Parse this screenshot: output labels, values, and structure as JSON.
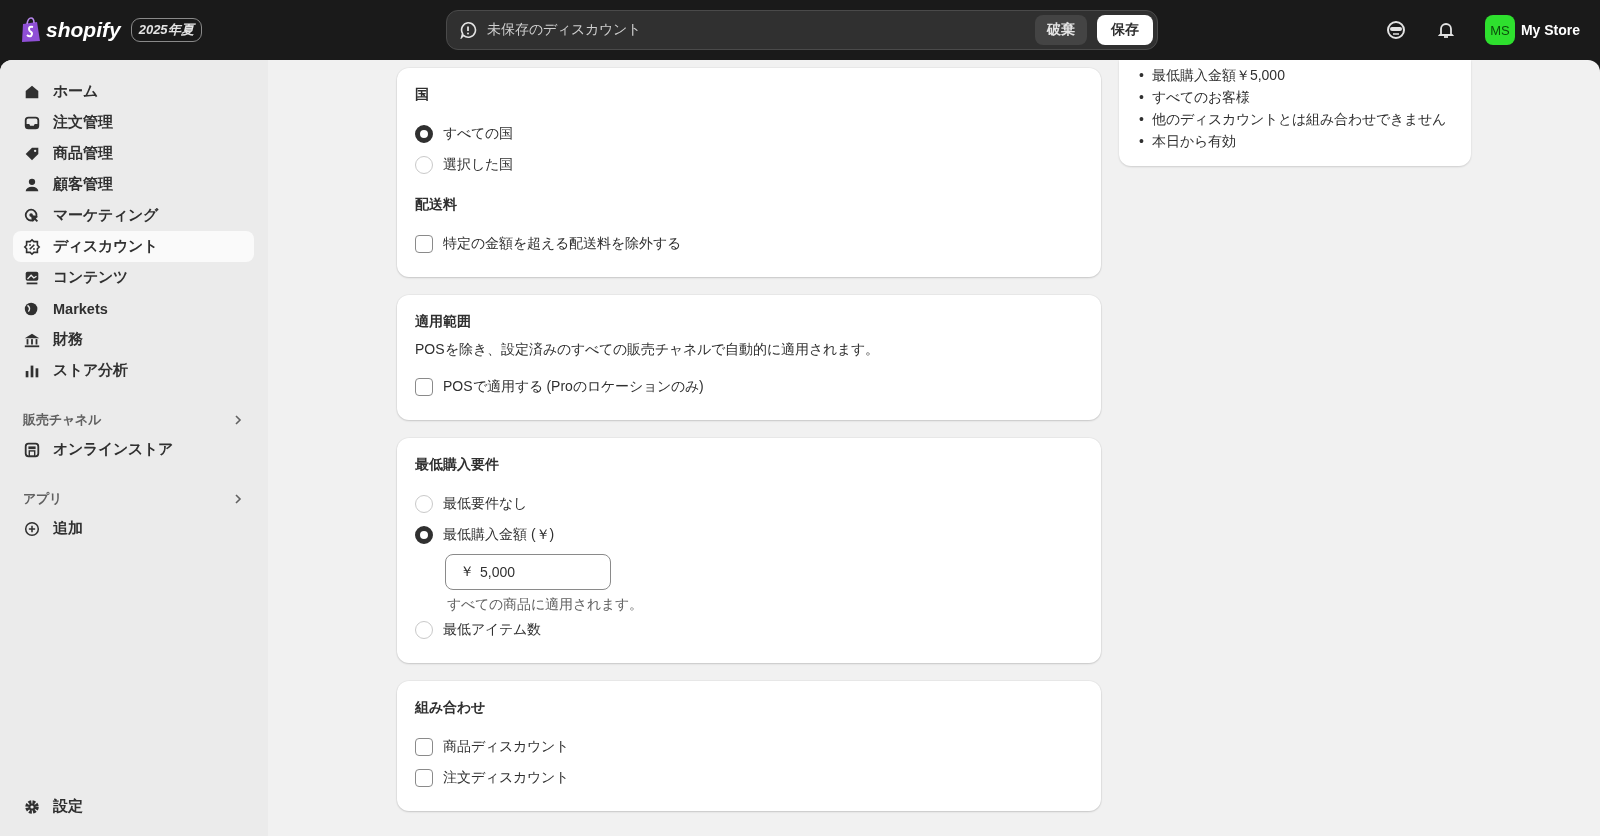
{
  "top_bar": {
    "logo": "shopify",
    "edition_badge": "2025年夏",
    "save_bar": {
      "message": "未保存のディスカウント",
      "discard": "破棄",
      "save": "保存"
    },
    "store": {
      "initials": "MS",
      "name": "My Store"
    }
  },
  "sidebar": {
    "items": [
      {
        "label": "ホーム",
        "selected": false
      },
      {
        "label": "注文管理",
        "selected": false
      },
      {
        "label": "商品管理",
        "selected": false
      },
      {
        "label": "顧客管理",
        "selected": false
      },
      {
        "label": "マーケティング",
        "selected": false
      },
      {
        "label": "ディスカウント",
        "selected": true
      },
      {
        "label": "コンテンツ",
        "selected": false
      },
      {
        "label": "Markets",
        "selected": false
      },
      {
        "label": "財務",
        "selected": false
      },
      {
        "label": "ストア分析",
        "selected": false
      }
    ],
    "sections": [
      {
        "title": "販売チャネル",
        "items": [
          {
            "label": "オンラインストア",
            "selected": false
          }
        ]
      },
      {
        "title": "アプリ",
        "items": [
          {
            "label": "追加",
            "selected": false
          }
        ]
      }
    ],
    "settings": "設定"
  },
  "cards": [
    {
      "sections": [
        {
          "title": "国",
          "options": [
            {
              "kind": "radio",
              "label": "すべての国",
              "selected": true
            },
            {
              "kind": "radio",
              "label": "選択した国",
              "selected": false
            }
          ]
        },
        {
          "title": "配送料",
          "options": [
            {
              "kind": "checkbox",
              "label": "特定の金額を超える配送料を除外する",
              "checked": false
            }
          ]
        }
      ]
    },
    {
      "sections": [
        {
          "title": "適用範囲",
          "description": "POSを除き、設定済みのすべての販売チャネルで自動的に適用されます。",
          "options": [
            {
              "kind": "checkbox",
              "label": "POSで適用する (Proのロケーションのみ)",
              "checked": false
            }
          ]
        }
      ]
    },
    {
      "sections": [
        {
          "title": "最低購入要件",
          "options": [
            {
              "kind": "radio",
              "label": "最低要件なし",
              "selected": false
            },
            {
              "kind": "radio",
              "label": "最低購入金額 (￥)",
              "selected": true,
              "field": {
                "prefix": "￥",
                "value": "5,000"
              },
              "help": "すべての商品に適用されます。"
            },
            {
              "kind": "radio",
              "label": "最低アイテム数",
              "selected": false
            }
          ]
        }
      ]
    },
    {
      "sections": [
        {
          "title": "組み合わせ",
          "options": [
            {
              "kind": "checkbox",
              "label": "商品ディスカウント",
              "checked": false
            },
            {
              "kind": "checkbox",
              "label": "注文ディスカウント",
              "checked": false
            }
          ]
        }
      ]
    }
  ],
  "summary": {
    "items": [
      {
        "bullet": "•",
        "text": "最低購入金額￥5,000"
      },
      {
        "bullet": "•",
        "text": "すべてのお客様"
      },
      {
        "bullet": "•",
        "text": "他のディスカウントとは組み合わせできません"
      },
      {
        "bullet": "•",
        "text": "本日から有効"
      }
    ]
  }
}
